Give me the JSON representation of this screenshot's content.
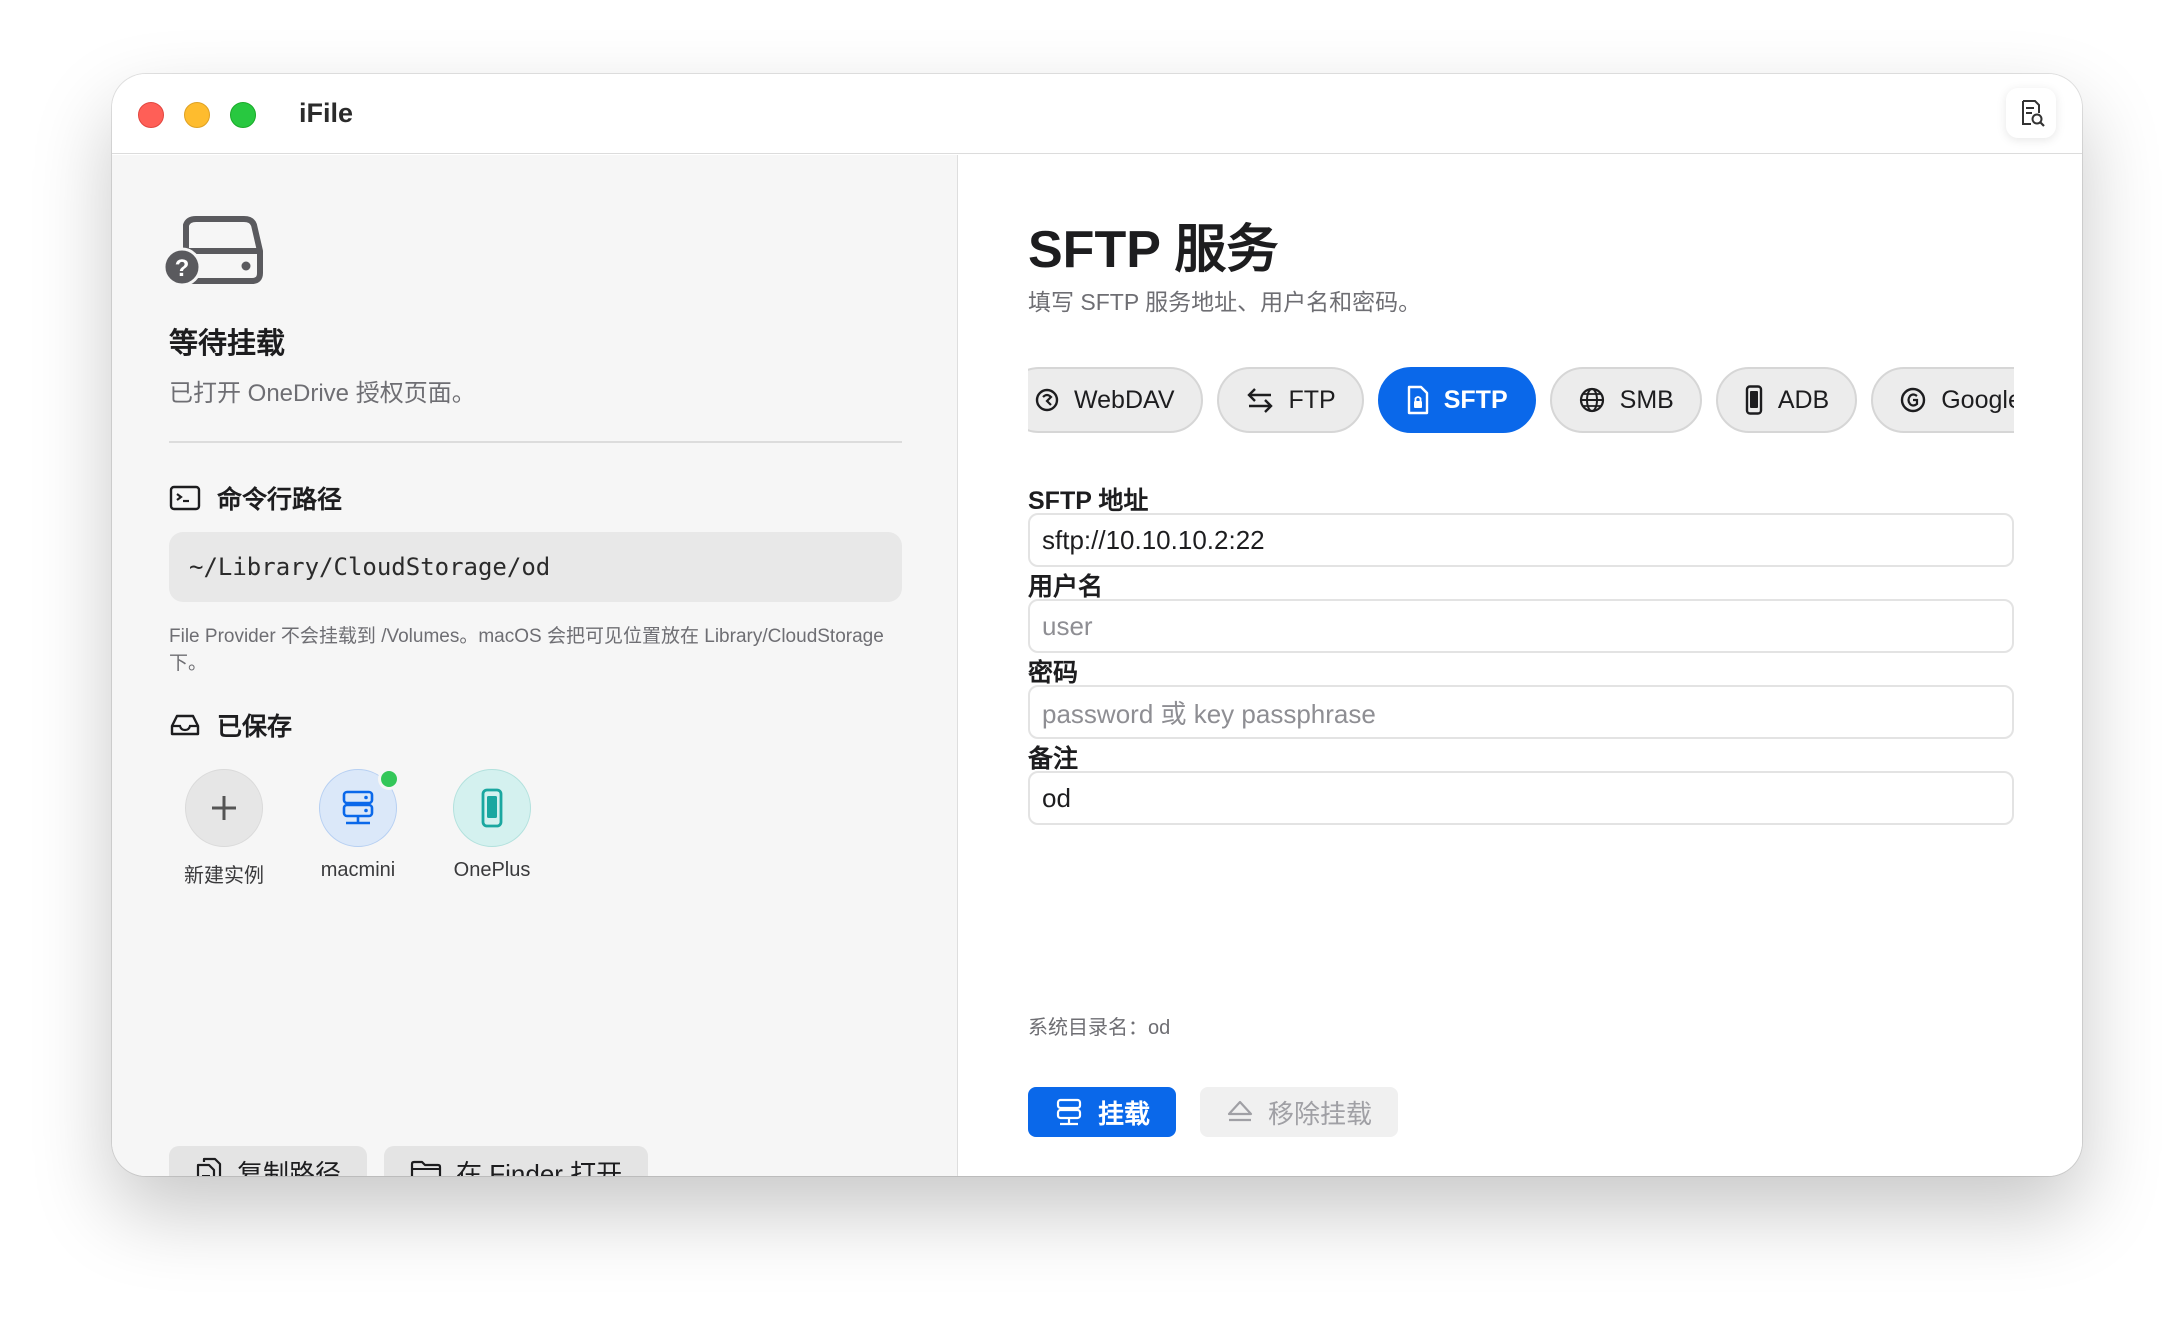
{
  "window": {
    "title": "iFile"
  },
  "sidebar": {
    "status_title": "等待挂载",
    "status_desc": "已打开 OneDrive 授权页面。",
    "cli_section_title": "命令行路径",
    "cli_path": "~/Library/CloudStorage/od",
    "path_note": "File Provider 不会挂载到 /Volumes。macOS 会把可见位置放在 Library/CloudStorage 下。",
    "saved_section_title": "已保存",
    "instances": [
      {
        "label": "新建实例",
        "icon": "plus-icon"
      },
      {
        "label": "macmini",
        "icon": "server-icon",
        "online": true
      },
      {
        "label": "OnePlus",
        "icon": "phone-icon"
      }
    ],
    "copy_path_label": "复制路径",
    "open_finder_label": "在 Finder 打开"
  },
  "main": {
    "title": "SFTP 服务",
    "subtitle": "填写 SFTP 服务地址、用户名和密码。",
    "protocols": [
      {
        "label": "WebDAV",
        "icon": "webdav-icon"
      },
      {
        "label": "FTP",
        "icon": "transfer-arrows-icon"
      },
      {
        "label": "SFTP",
        "icon": "locked-document-icon",
        "active": true
      },
      {
        "label": "SMB",
        "icon": "globe-icon"
      },
      {
        "label": "ADB",
        "icon": "phone-icon"
      },
      {
        "label": "Google D",
        "icon": "google-icon"
      }
    ],
    "address_label": "SFTP 地址",
    "address_value": "sftp://10.10.10.2:22",
    "username_label": "用户名",
    "username_placeholder": "user",
    "password_label": "密码",
    "password_placeholder": "password 或 key passphrase",
    "note_label": "备注",
    "note_value": "od",
    "system_dir": "系统目录名：od",
    "mount_label": "挂载",
    "unmount_label": "移除挂载"
  },
  "colors": {
    "accent": "#0a68ea",
    "online": "#34c759"
  }
}
